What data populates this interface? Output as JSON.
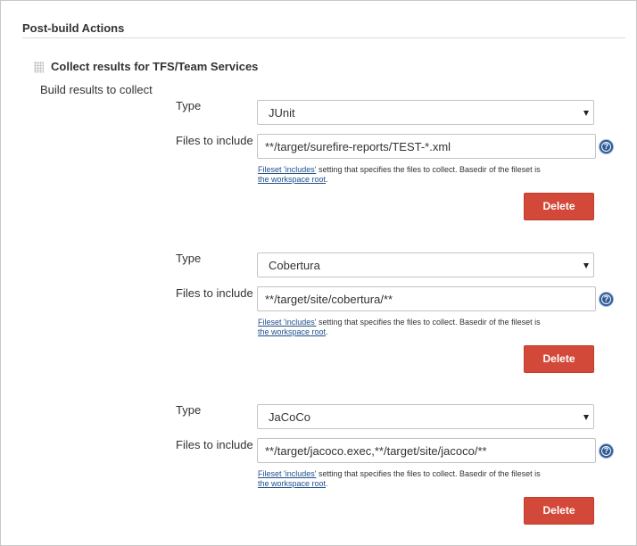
{
  "section": {
    "title": "Post-build Actions"
  },
  "action": {
    "title": "Collect results for TFS/Team Services",
    "collect_label": "Build results to collect"
  },
  "entries": [
    {
      "type_label": "Type",
      "type_value": "JUnit",
      "files_label": "Files to include",
      "files_value": "**/target/surefire-reports/TEST-*.xml",
      "help_link1": "Fileset 'includes'",
      "help_text": " setting that specifies the files to collect. Basedir of the fileset is ",
      "help_link2": "the workspace root",
      "help_end": ".",
      "delete_label": "Delete"
    },
    {
      "type_label": "Type",
      "type_value": "Cobertura",
      "files_label": "Files to include",
      "files_value": "**/target/site/cobertura/**",
      "help_link1": "Fileset 'includes'",
      "help_text": " setting that specifies the files to collect. Basedir of the fileset is ",
      "help_link2": "the workspace root",
      "help_end": ".",
      "delete_label": "Delete"
    },
    {
      "type_label": "Type",
      "type_value": "JaCoCo",
      "files_label": "Files to include",
      "files_value": "**/target/jacoco.exec,**/target/site/jacoco/**",
      "help_link1": "Fileset 'includes'",
      "help_text": " setting that specifies the files to collect. Basedir of the fileset is ",
      "help_link2": "the workspace root",
      "help_end": ".",
      "delete_label": "Delete"
    }
  ],
  "icons": {
    "help": "help-icon",
    "drag": "drag-handle-icon",
    "dropdown": "chevron-down-icon"
  },
  "help_glyph": "?",
  "colors": {
    "delete_button": "#d24939",
    "help_icon": "#2d5a95",
    "link": "#1f4e8c"
  }
}
